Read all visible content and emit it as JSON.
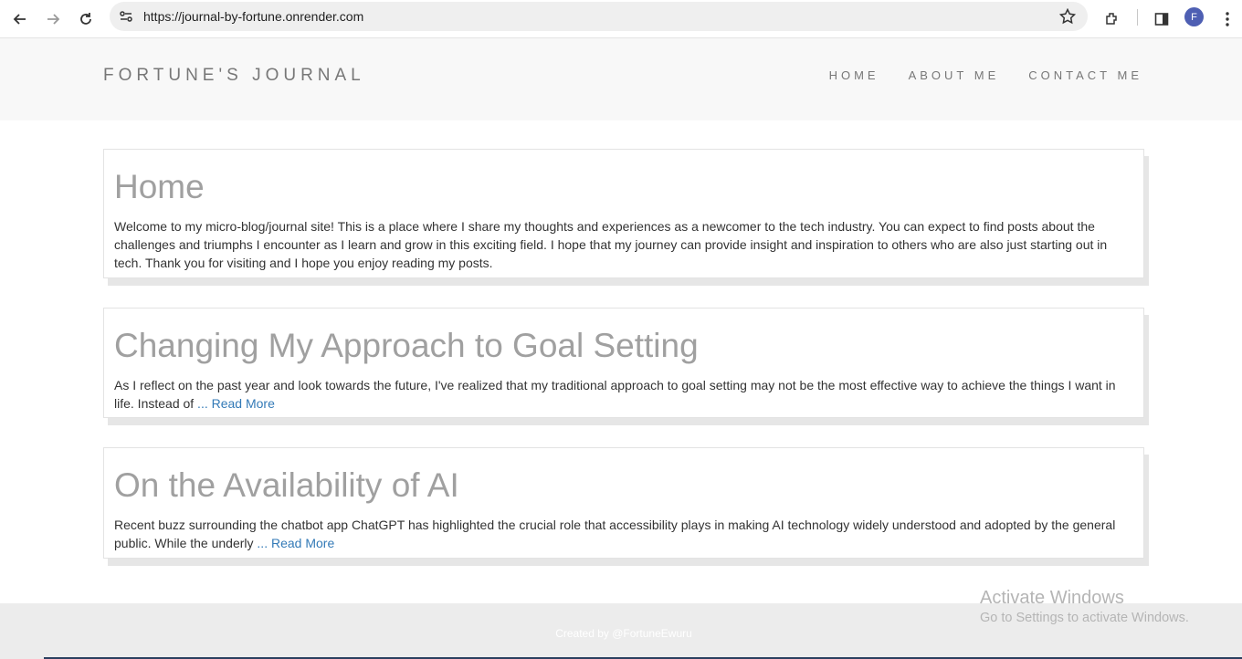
{
  "browser": {
    "url": "https://journal-by-fortune.onrender.com",
    "profile_initial": "F"
  },
  "header": {
    "brand": "FORTUNE'S JOURNAL",
    "nav": [
      "HOME",
      "ABOUT ME",
      "CONTACT ME"
    ]
  },
  "posts": [
    {
      "title": "Home",
      "body": "Welcome to my micro-blog/journal site! This is a place where I share my thoughts and experiences as a newcomer to the tech industry. You can expect to find posts about the challenges and triumphs I encounter as I learn and grow in this exciting field. I hope that my journey can provide insight and inspiration to others who are also just starting out in tech. Thank you for visiting and I hope you enjoy reading my posts."
    },
    {
      "title": "Changing My Approach to Goal Setting",
      "body": "As I reflect on the past year and look towards the future, I've realized that my traditional approach to goal setting may not be the most effective way to achieve the things I want in life. Instead of",
      "ellipsis": " ... ",
      "read_more": "Read More"
    },
    {
      "title": "On the Availability of AI",
      "body": "Recent buzz surrounding the chatbot app ChatGPT has highlighted the crucial role that accessibility plays in making AI technology widely understood and adopted by the general public. While the underly",
      "ellipsis": " ... ",
      "read_more": "Read More"
    }
  ],
  "footer": {
    "credit": "Created by @FortuneEwuru"
  },
  "watermark": {
    "line1": "Activate Windows",
    "line2": "Go to Settings to activate Windows."
  }
}
